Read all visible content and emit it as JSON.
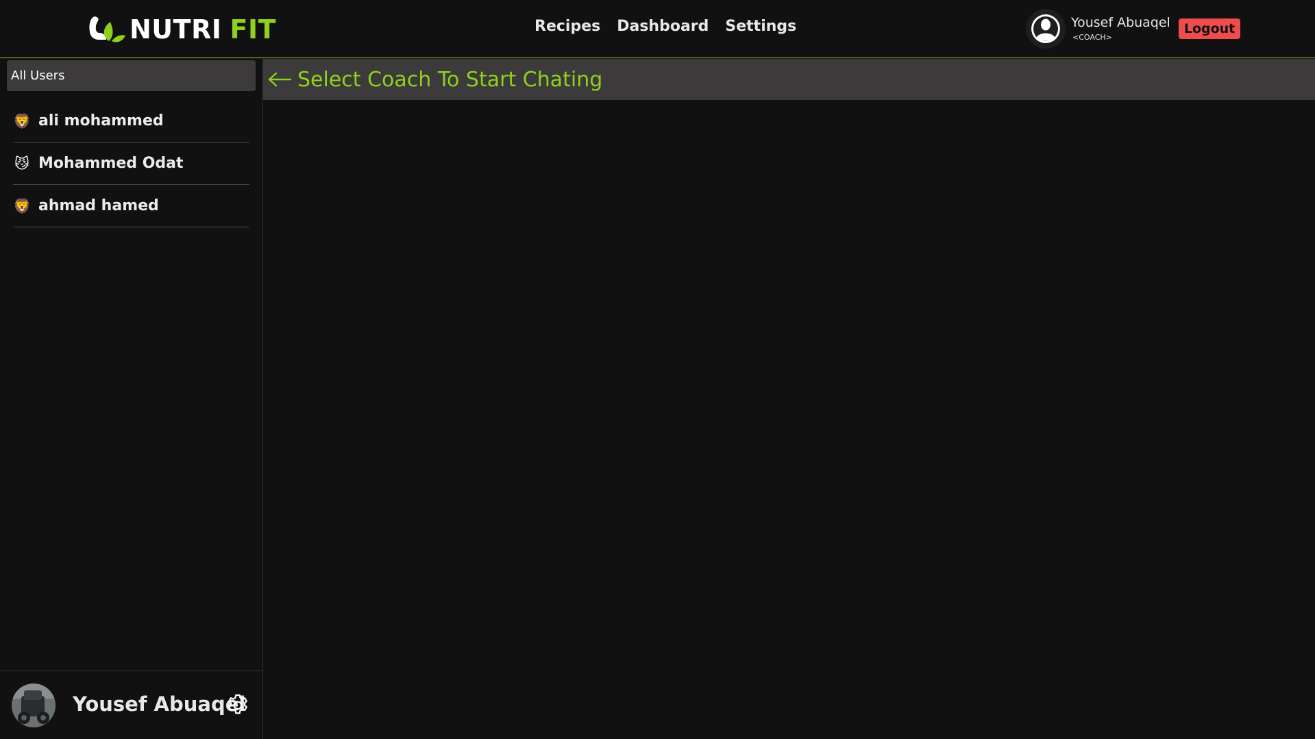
{
  "brand": {
    "word1": "NUTRI",
    "word2": "FIT",
    "logo_icon": "muscle-leaf-icon",
    "accent_color": "#8ed11d"
  },
  "nav": {
    "links": [
      "Recipes",
      "Dashboard",
      "Settings"
    ]
  },
  "header_user": {
    "name": "Yousef Abuaqel",
    "role": "<COACH>",
    "logout_label": "Logout",
    "logout_color": "#ef4d4d",
    "avatar_icon": "user-avatar-icon"
  },
  "sidebar": {
    "all_users_label": "All Users",
    "users": [
      {
        "name": "ali mohammed",
        "icon": "lion-emoji-icon",
        "glyph": "🦁"
      },
      {
        "name": "Mohammed Odat",
        "icon": "cat-emoji-icon",
        "glyph": "😼"
      },
      {
        "name": "ahmad hamed",
        "icon": "lion-emoji-icon",
        "glyph": "🦁"
      }
    ],
    "footer": {
      "name": "Yousef Abuaqel",
      "avatar_icon": "profile-photo",
      "settings_icon": "gear-icon"
    }
  },
  "main": {
    "title": "Select Coach To Start Chating",
    "back_icon": "arrow-left-icon"
  },
  "colors": {
    "background": "#111111",
    "panel": "#3c3a3a",
    "accent": "#8ed11d"
  }
}
